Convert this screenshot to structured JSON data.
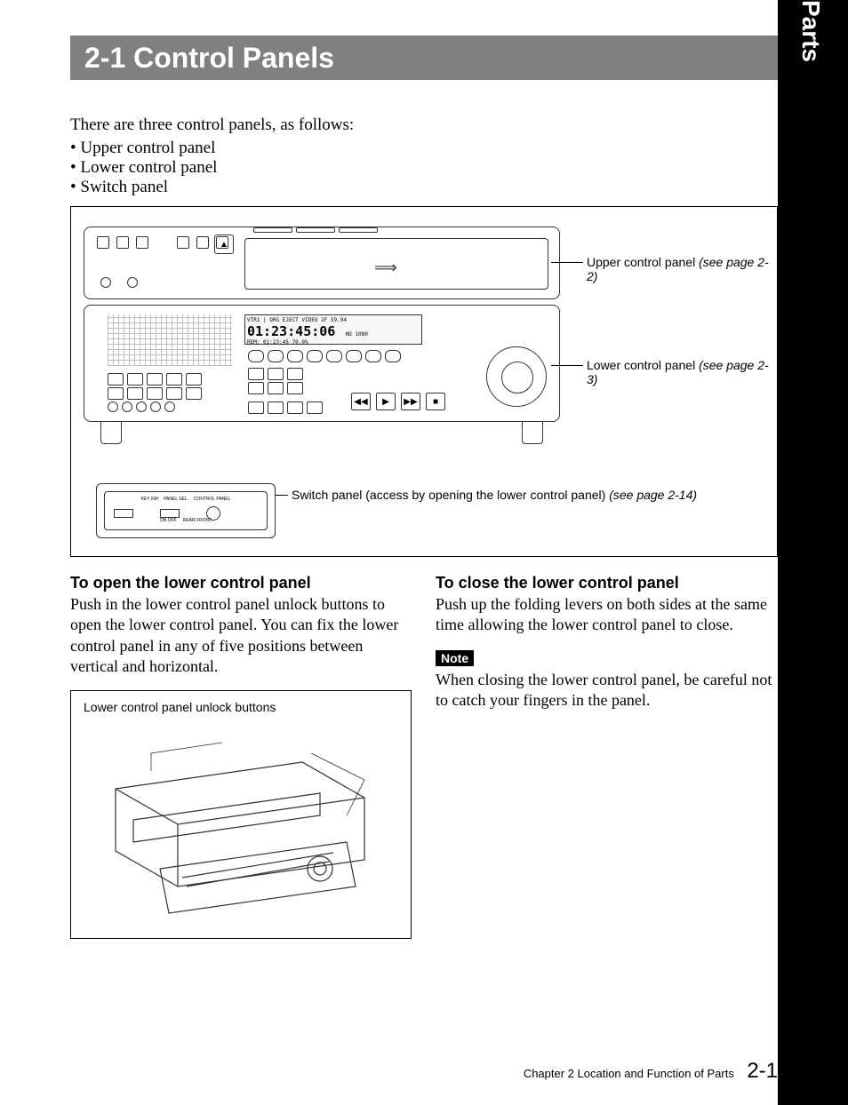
{
  "sidebar": {
    "text": "Chapter 2  Location and Function of Parts"
  },
  "title": "2-1  Control Panels",
  "intro": {
    "lead": "There are three control panels, as follows:",
    "items": [
      "Upper control panel",
      "Lower control panel",
      "Switch panel"
    ]
  },
  "figure1": {
    "timecode": "01:23:45:06",
    "lcd_top": "VTR1 | ORG EJECT VIDEO   2F   59.94",
    "lcd_mid": "HD   1080",
    "lcd_bottom": "REM: 01:23:45   70.0%",
    "callouts": {
      "upper": {
        "label": "Upper control panel ",
        "ref": "(see page 2-2)"
      },
      "lower": {
        "label": "Lower control panel ",
        "ref": "(see page 2-3)"
      },
      "switch": {
        "label": "Switch panel (access by opening the lower control panel) ",
        "ref": "(see page 2-14)"
      }
    },
    "switch_labels": {
      "l1": "KEY INH",
      "l2": "PANEL SEL.",
      "l3": "CONTROL PANEL",
      "b1": "ON   OFF",
      "b2": "REAR   FRONT"
    }
  },
  "columns": {
    "open": {
      "heading": "To open the lower control panel",
      "body": "Push in the lower control panel unlock buttons to open the lower control panel. You can fix the lower control panel in any of five positions between vertical and horizontal.",
      "fig_caption": "Lower control panel unlock buttons"
    },
    "close": {
      "heading": "To close the lower control panel",
      "body": "Push up the folding levers on both sides at the same time allowing the lower control panel to close.",
      "note_label": "Note",
      "note_body": "When closing the lower control panel, be careful not to catch your fingers in the panel."
    }
  },
  "footer": {
    "chapter": "Chapter 2   Location and Function of Parts",
    "page": "2-1"
  }
}
